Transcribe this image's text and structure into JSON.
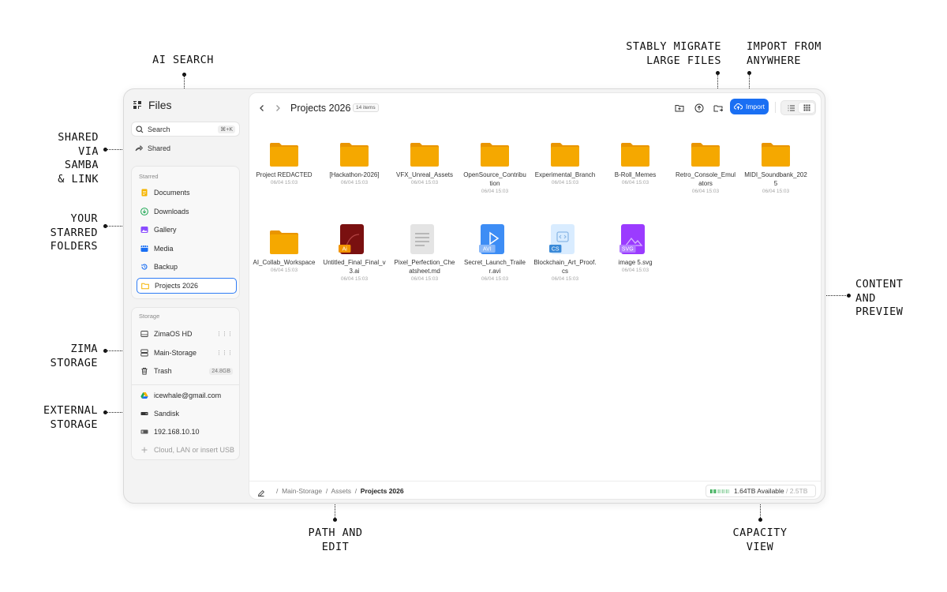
{
  "annotations": {
    "ai_search": "AI SEARCH",
    "stably_migrate": "STABLY MIGRATE\nLARGE FILES",
    "import_from": "IMPORT FROM\nANYWHERE",
    "shared_via": "SHARED\nVIA\nSAMBA\n& LINK",
    "starred_folders": "YOUR\nSTARRED\nFOLDERS",
    "zima_storage": "ZIMA\nSTORAGE",
    "external_storage": "EXTERNAL\nSTORAGE",
    "content_preview": "CONTENT\nAND\nPREVIEW",
    "path_edit": "PATH AND\nEDIT",
    "capacity_view": "CAPACITY\nVIEW"
  },
  "app": {
    "logo": "ZIMA",
    "title": "Files"
  },
  "search": {
    "label": "Search",
    "shortcut": "⌘+K"
  },
  "shared": {
    "label": "Shared"
  },
  "starred": {
    "title": "Starred",
    "items": [
      {
        "label": "Documents",
        "icon": "document-icon",
        "color": "#f5b400"
      },
      {
        "label": "Downloads",
        "icon": "download-icon",
        "color": "#1fa854"
      },
      {
        "label": "Gallery",
        "icon": "gallery-icon",
        "color": "#8a4dff"
      },
      {
        "label": "Media",
        "icon": "media-icon",
        "color": "#1a6ff3"
      },
      {
        "label": "Backup",
        "icon": "backup-icon",
        "color": "#1a6ff3"
      },
      {
        "label": "Projects 2026",
        "icon": "folder-icon",
        "color": "#f5b400"
      }
    ]
  },
  "storage": {
    "title": "Storage",
    "items": [
      {
        "label": "ZimaOS HD",
        "icon": "disk-icon",
        "trail": "⋮⋮⋮"
      },
      {
        "label": "Main-Storage",
        "icon": "server-icon",
        "trail": "⋮⋮⋮"
      },
      {
        "label": "Trash",
        "icon": "trash-icon",
        "trail": "24.8GB"
      }
    ],
    "external": [
      {
        "label": "icewhale@gmail.com",
        "icon": "google-drive-icon"
      },
      {
        "label": "Sandisk",
        "icon": "usb-drive-icon"
      },
      {
        "label": "192.168.10.10",
        "icon": "network-drive-icon"
      },
      {
        "label": "Cloud, LAN or insert USB",
        "icon": "plus-icon"
      }
    ]
  },
  "header": {
    "title": "Projects 2026",
    "count": "14 items",
    "import_label": "Import"
  },
  "files": [
    {
      "name": "Project REDACTED",
      "date": "06/04 15:03",
      "type": "folder"
    },
    {
      "name": "[Hackathon-2026]",
      "date": "06/04 15:03",
      "type": "folder"
    },
    {
      "name": "VFX_Unreal_Assets",
      "date": "06/04 15:03",
      "type": "folder"
    },
    {
      "name": "OpenSource_Contribution",
      "date": "06/04 15:03",
      "type": "folder"
    },
    {
      "name": "Experimental_Branch",
      "date": "06/04 15:03",
      "type": "folder"
    },
    {
      "name": "B-Roll_Memes",
      "date": "06/04 15:03",
      "type": "folder"
    },
    {
      "name": "Retro_Console_Emulators",
      "date": "06/04 15:03",
      "type": "folder"
    },
    {
      "name": "MIDI_Soundbank_2025",
      "date": "06/04 15:03",
      "type": "folder"
    },
    {
      "name": "AI_Collab_Workspace",
      "date": "06/04 15:03",
      "type": "folder"
    },
    {
      "name": "Untitled_Final_Final_v3.ai",
      "date": "06/04 15:03",
      "type": "ai",
      "badge": "Ai",
      "color": "#7a1010",
      "badgeColor": "#f29400"
    },
    {
      "name": "Pixel_Perfection_Cheatsheet.md",
      "date": "06/04 15:03",
      "type": "md",
      "color": "#e4e4e4"
    },
    {
      "name": "Secret_Launch_Trailer.avi",
      "date": "06/04 15:03",
      "type": "avi",
      "badge": "AVI",
      "color": "#3d8df5",
      "badgeColor": "#8ab8f8"
    },
    {
      "name": "Blockchain_Art_Proof.cs",
      "date": "06/04 15:03",
      "type": "cs",
      "badge": "CS",
      "color": "#d9ecff",
      "badgeColor": "#3a8ad8"
    },
    {
      "name": "image 5.svg",
      "date": "06/04 15:03",
      "type": "svg",
      "badge": "SVG",
      "color": "#9b3bff",
      "badgeColor": "#b37aff"
    }
  ],
  "footer": {
    "path": [
      "Main-Storage",
      "Assets"
    ],
    "current": "Projects 2026",
    "available": "1.64TB Available",
    "total": "/ 2.5TB",
    "used_fraction": 0.34
  },
  "colors": {
    "accent": "#1a6ff3",
    "folder": "#f5a800",
    "folder_dark": "#e99500"
  }
}
